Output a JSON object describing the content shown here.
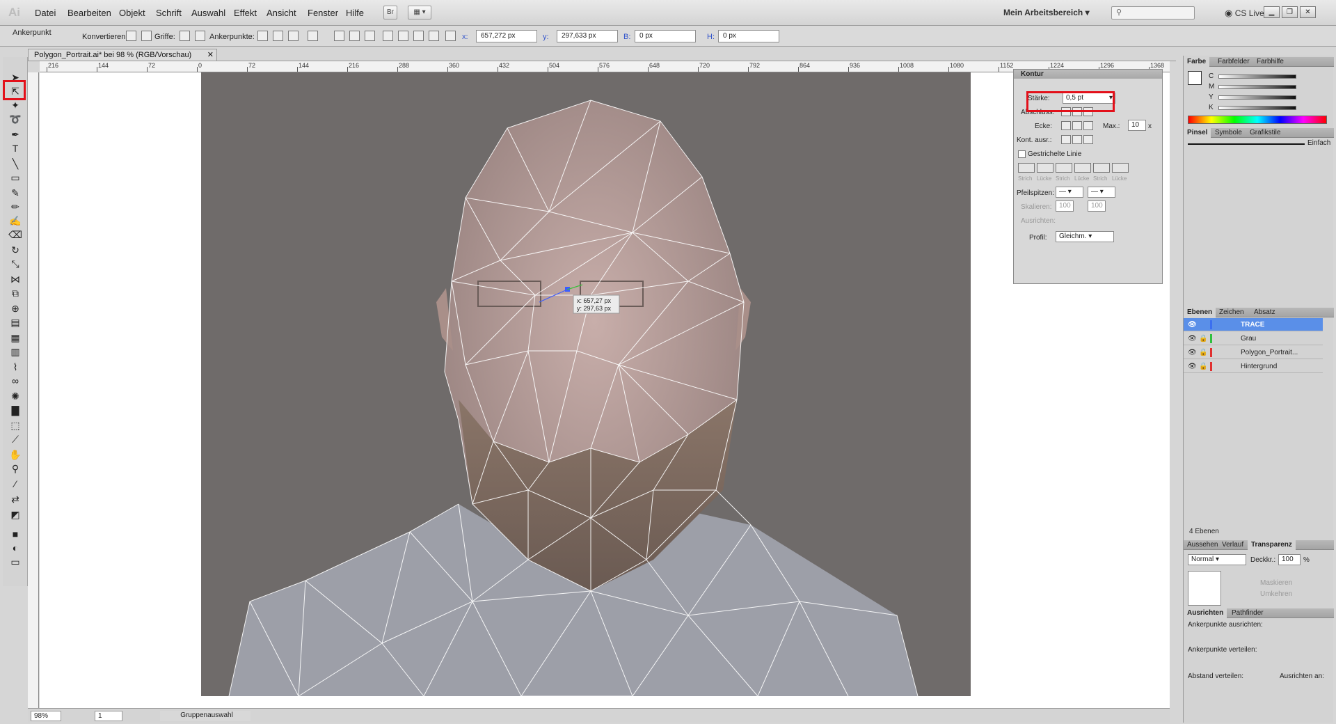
{
  "app": {
    "logo": "Ai"
  },
  "menu": [
    "Datei",
    "Bearbeiten",
    "Objekt",
    "Schrift",
    "Auswahl",
    "Effekt",
    "Ansicht",
    "Fenster",
    "Hilfe"
  ],
  "bridge_button": "Br",
  "workspace": "Mein Arbeitsbereich",
  "cs_live": "CS Live",
  "control": {
    "tool_name": "Ankerpunkt",
    "konvertieren": "Konvertieren:",
    "griffe": "Griffe:",
    "ankerpunkte": "Ankerpunkte:",
    "x_label": "x:",
    "x_value": "657,272 px",
    "y_label": "y:",
    "y_value": "297,633 px",
    "b_label": "B:",
    "b_value": "0 px",
    "h_label": "H:",
    "h_value": "0 px"
  },
  "document": {
    "tab": "Polygon_Portrait.ai* bei 98 % (RGB/Vorschau)",
    "ruler_labels": [
      "216",
      "144",
      "72",
      "0",
      "72",
      "144",
      "216",
      "288",
      "360",
      "432",
      "504",
      "576",
      "648",
      "720",
      "792",
      "864",
      "936",
      "1008",
      "1080",
      "1152",
      "1224",
      "1296",
      "1368"
    ],
    "cursor_x": "x: 657,27 px",
    "cursor_y": "y: 297,63 px"
  },
  "status": {
    "zoom": "98%",
    "page": "1",
    "mode": "Gruppenauswahl"
  },
  "kontur": {
    "title": "Kontur",
    "staerke_label": "Stärke:",
    "staerke_value": "0,5 pt",
    "abschluss_label": "Abschluss:",
    "ecke_label": "Ecke:",
    "max_label": "Max.:",
    "max_value": "10",
    "max_unit": "x",
    "kont_label": "Kont. ausr.:",
    "dash_label": "Gestrichelte Linie",
    "dash_cols": [
      "Strich",
      "Lücke",
      "Strich",
      "Lücke",
      "Strich",
      "Lücke"
    ],
    "pfeil_label": "Pfeilspitzen:",
    "skalieren_label": "Skalieren:",
    "skalieren_1": "100",
    "skalieren_2": "100",
    "pct": "%",
    "ausrichten_label": "Ausrichten:",
    "profil_label": "Profil:",
    "profil_value": "Gleichm."
  },
  "farbe": {
    "tabs": [
      "Farbe",
      "Farbfelder",
      "Farbhilfe"
    ],
    "channels": [
      "C",
      "M",
      "Y",
      "K"
    ],
    "pct": "%"
  },
  "pinsel": {
    "tabs": [
      "Pinsel",
      "Symbole",
      "Grafikstile"
    ],
    "brush": "Einfach"
  },
  "ebenen": {
    "tabs": [
      "Ebenen",
      "Zeichen",
      "Absatz"
    ],
    "layers": [
      {
        "name": "TRACE",
        "color": "#3b6ff0",
        "selected": true
      },
      {
        "name": "Grau",
        "color": "#2fbf3f",
        "selected": false
      },
      {
        "name": "Polygon_Portrait...",
        "color": "#e03030",
        "selected": false
      },
      {
        "name": "Hintergrund",
        "color": "#e03030",
        "selected": false
      }
    ],
    "count": "4 Ebenen"
  },
  "transparenz": {
    "tabs": [
      "Aussehen",
      "Verlauf",
      "Transparenz"
    ],
    "mode": "Normal",
    "deckkr_label": "Deckkr.:",
    "deckkr_value": "100",
    "pct": "%",
    "maskieren": "Maskieren",
    "umkehren": "Umkehren"
  },
  "ausrichten": {
    "tabs": [
      "Ausrichten",
      "Pathfinder"
    ],
    "anker": "Ankerpunkte ausrichten:",
    "verteilen": "Ankerpunkte verteilen:",
    "abstand": "Abstand verteilen:",
    "an": "Ausrichten an:"
  }
}
